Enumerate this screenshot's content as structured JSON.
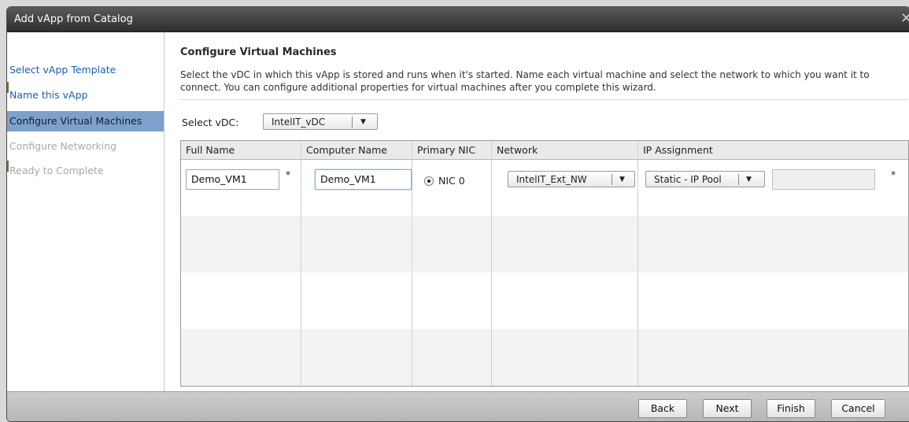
{
  "window": {
    "title": "Add vApp from Catalog",
    "close_glyph": "✕"
  },
  "sidebar": {
    "items": [
      {
        "label": "Select vApp Template",
        "state": "link"
      },
      {
        "label": "Name this vApp",
        "state": "link"
      },
      {
        "label": "Configure Virtual Machines",
        "state": "active"
      },
      {
        "label": "Configure Networking",
        "state": "disabled"
      },
      {
        "label": "Ready to Complete",
        "state": "disabled"
      }
    ]
  },
  "main": {
    "heading": "Configure Virtual Machines",
    "description": "Select the vDC in which this vApp is stored and runs when it's started. Name each virtual machine and select the network to which you want it to connect. You can configure additional properties for virtual machines after you complete this wizard.",
    "vdc_label": "Select vDC:",
    "vdc_value": "IntelIT_vDC",
    "table": {
      "columns": [
        "Full Name",
        "Computer Name",
        "Primary NIC",
        "Network",
        "IP Assignment"
      ],
      "row": {
        "full_name": "Demo_VM1",
        "required_mark": "*",
        "computer_name": "Demo_VM1",
        "nic": "NIC 0",
        "network": "IntelIT_Ext_NW",
        "ip_assignment": "Static - IP Pool",
        "ip_address": "",
        "ip_required_mark": "*"
      }
    }
  },
  "footer": {
    "back": "Back",
    "next": "Next",
    "finish": "Finish",
    "cancel": "Cancel"
  },
  "icons": {
    "dropdown": "▼"
  },
  "colors": {
    "active_item": "#7ea1cc",
    "link": "#1e5fa8"
  }
}
